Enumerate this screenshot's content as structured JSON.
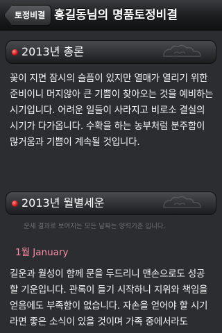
{
  "nav": {
    "back_label": "토정비결",
    "title": "홍길동님의 명품토정비결"
  },
  "sections": [
    {
      "title": "2013년 총론",
      "text": "꽃이 지면 잠시의 슬픔이 있지만 열매가 열리기 위한 준비이니 머지않아 큰 기쁨이 찾아오는 것을 예비하는 시기입니다. 어려운 일들이 사라지고 비로소 결실의 시기가 다가옵니다. 수확을 하는 농부처럼 분주함이 많거움과 기쁨이 계속될 것입니다."
    },
    {
      "title": "2013년 월별세운",
      "note": "운세 결과로 보여지는 모든 날짜는 양력기준 입니다.",
      "months": [
        {
          "label": "1월 January",
          "text": "길운과 월성이 함께 문을 두드리니 맨손으로도 성공 할 기운입니다. 관록이 들기 시작하니 지위와 책임을 얻음에도 부족함이 없습니다. 자손을 얻어야 할 시기라면 좋은 소식이 있을 것이며 가족 중에서라도"
        }
      ]
    }
  ],
  "colors": {
    "background": "#2b2d31",
    "accent_red": "#d01010",
    "month_label": "#ff8da8",
    "note_text": "#6e7074"
  },
  "icons": {
    "section_bullet": "red-dot-icon",
    "header_ornament": "cloud-pattern-icon",
    "back": "back-arrow-icon"
  }
}
